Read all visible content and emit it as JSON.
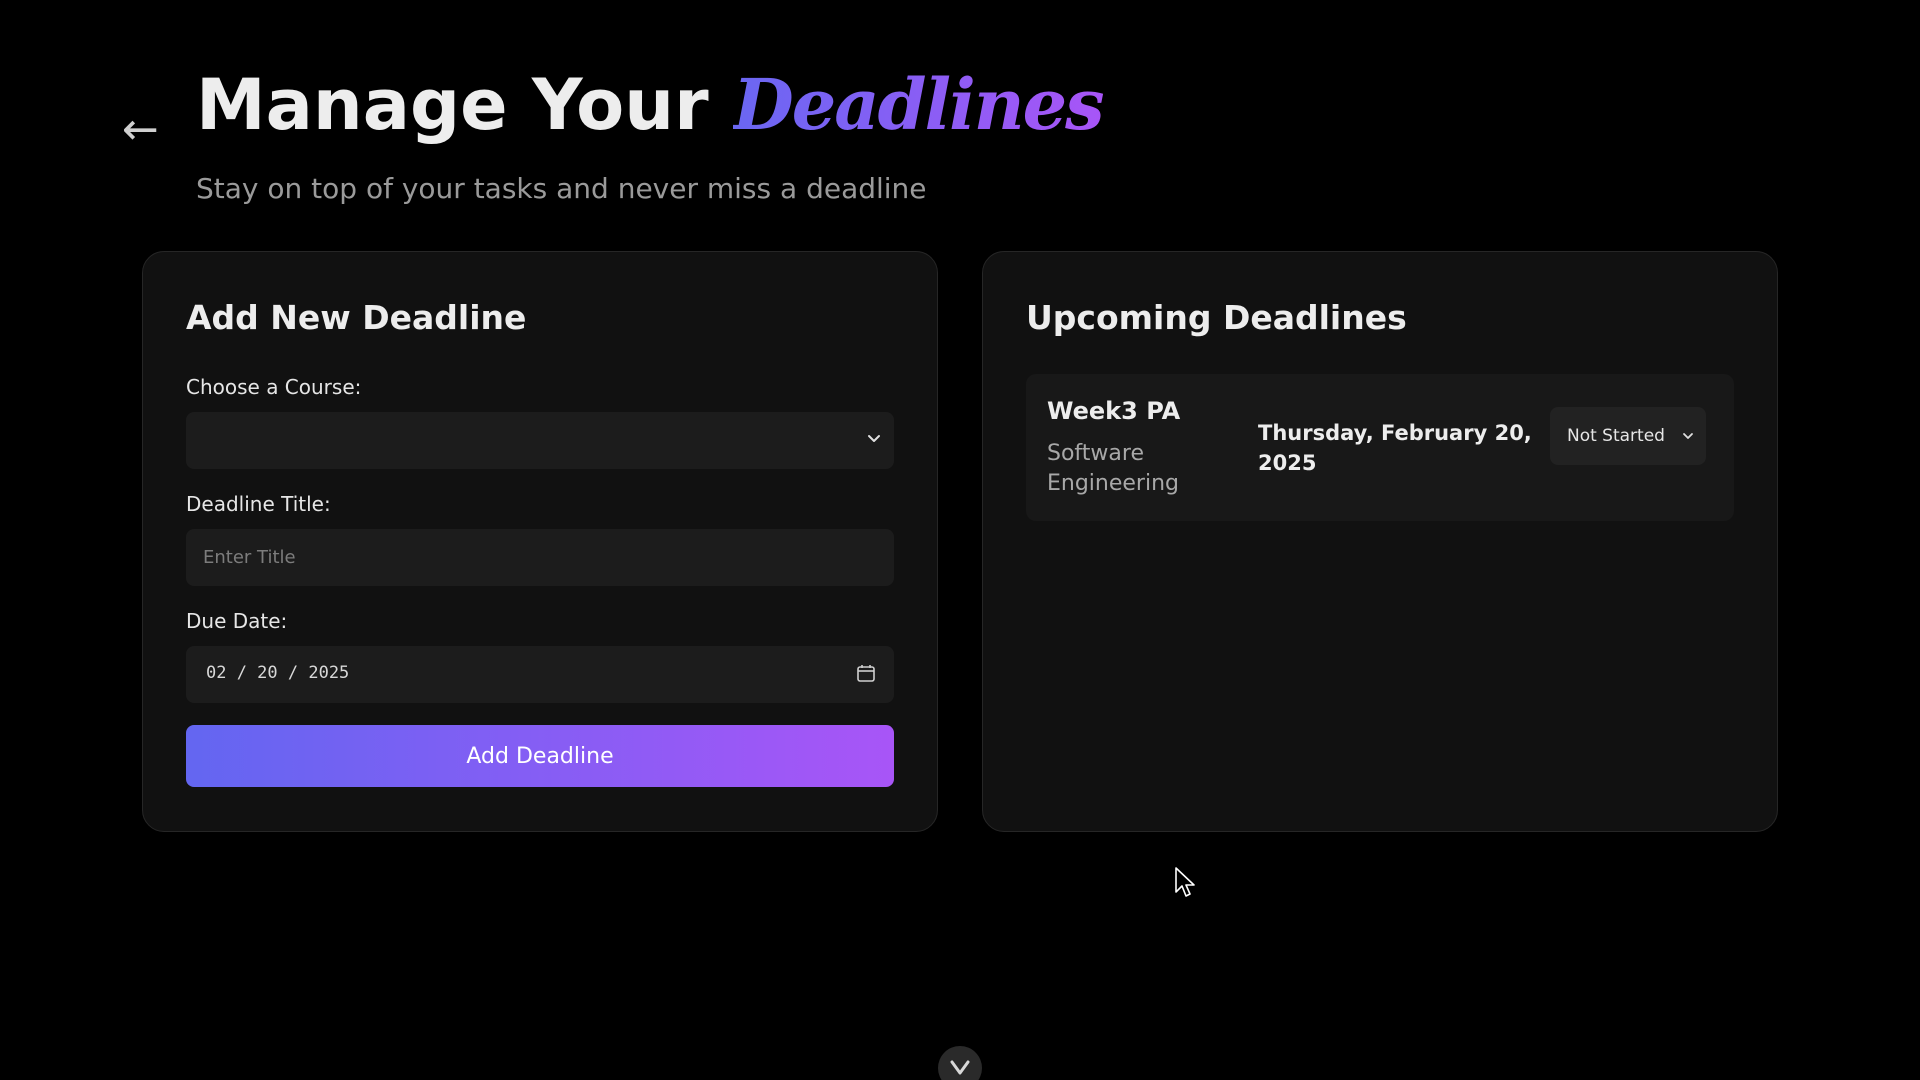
{
  "header": {
    "back_label": "←",
    "title_prefix": "Manage Your",
    "title_accent": "Deadlines",
    "subtitle": "Stay on top of your tasks and never miss a deadline"
  },
  "add_form": {
    "heading": "Add New Deadline",
    "course_label": "Choose a Course:",
    "course_value": "",
    "title_label": "Deadline Title:",
    "title_value": "",
    "title_placeholder": "Enter Title",
    "due_label": "Due Date:",
    "due_value": "02 / 20 / 2025",
    "submit_label": "Add Deadline"
  },
  "upcoming": {
    "heading": "Upcoming Deadlines",
    "items": [
      {
        "name": "Week3 PA",
        "course": "Software Engineering",
        "date": "Thursday, February 20, 2025",
        "status": "Not Started"
      }
    ]
  },
  "colors": {
    "background": "#000000",
    "card": "#111111",
    "accent_start": "#6366f1",
    "accent_end": "#a855f7"
  },
  "icons": {
    "back": "arrow-left-icon",
    "select": "chevron-down-icon",
    "date": "calendar-icon",
    "scroll": "chevron-down-icon"
  }
}
